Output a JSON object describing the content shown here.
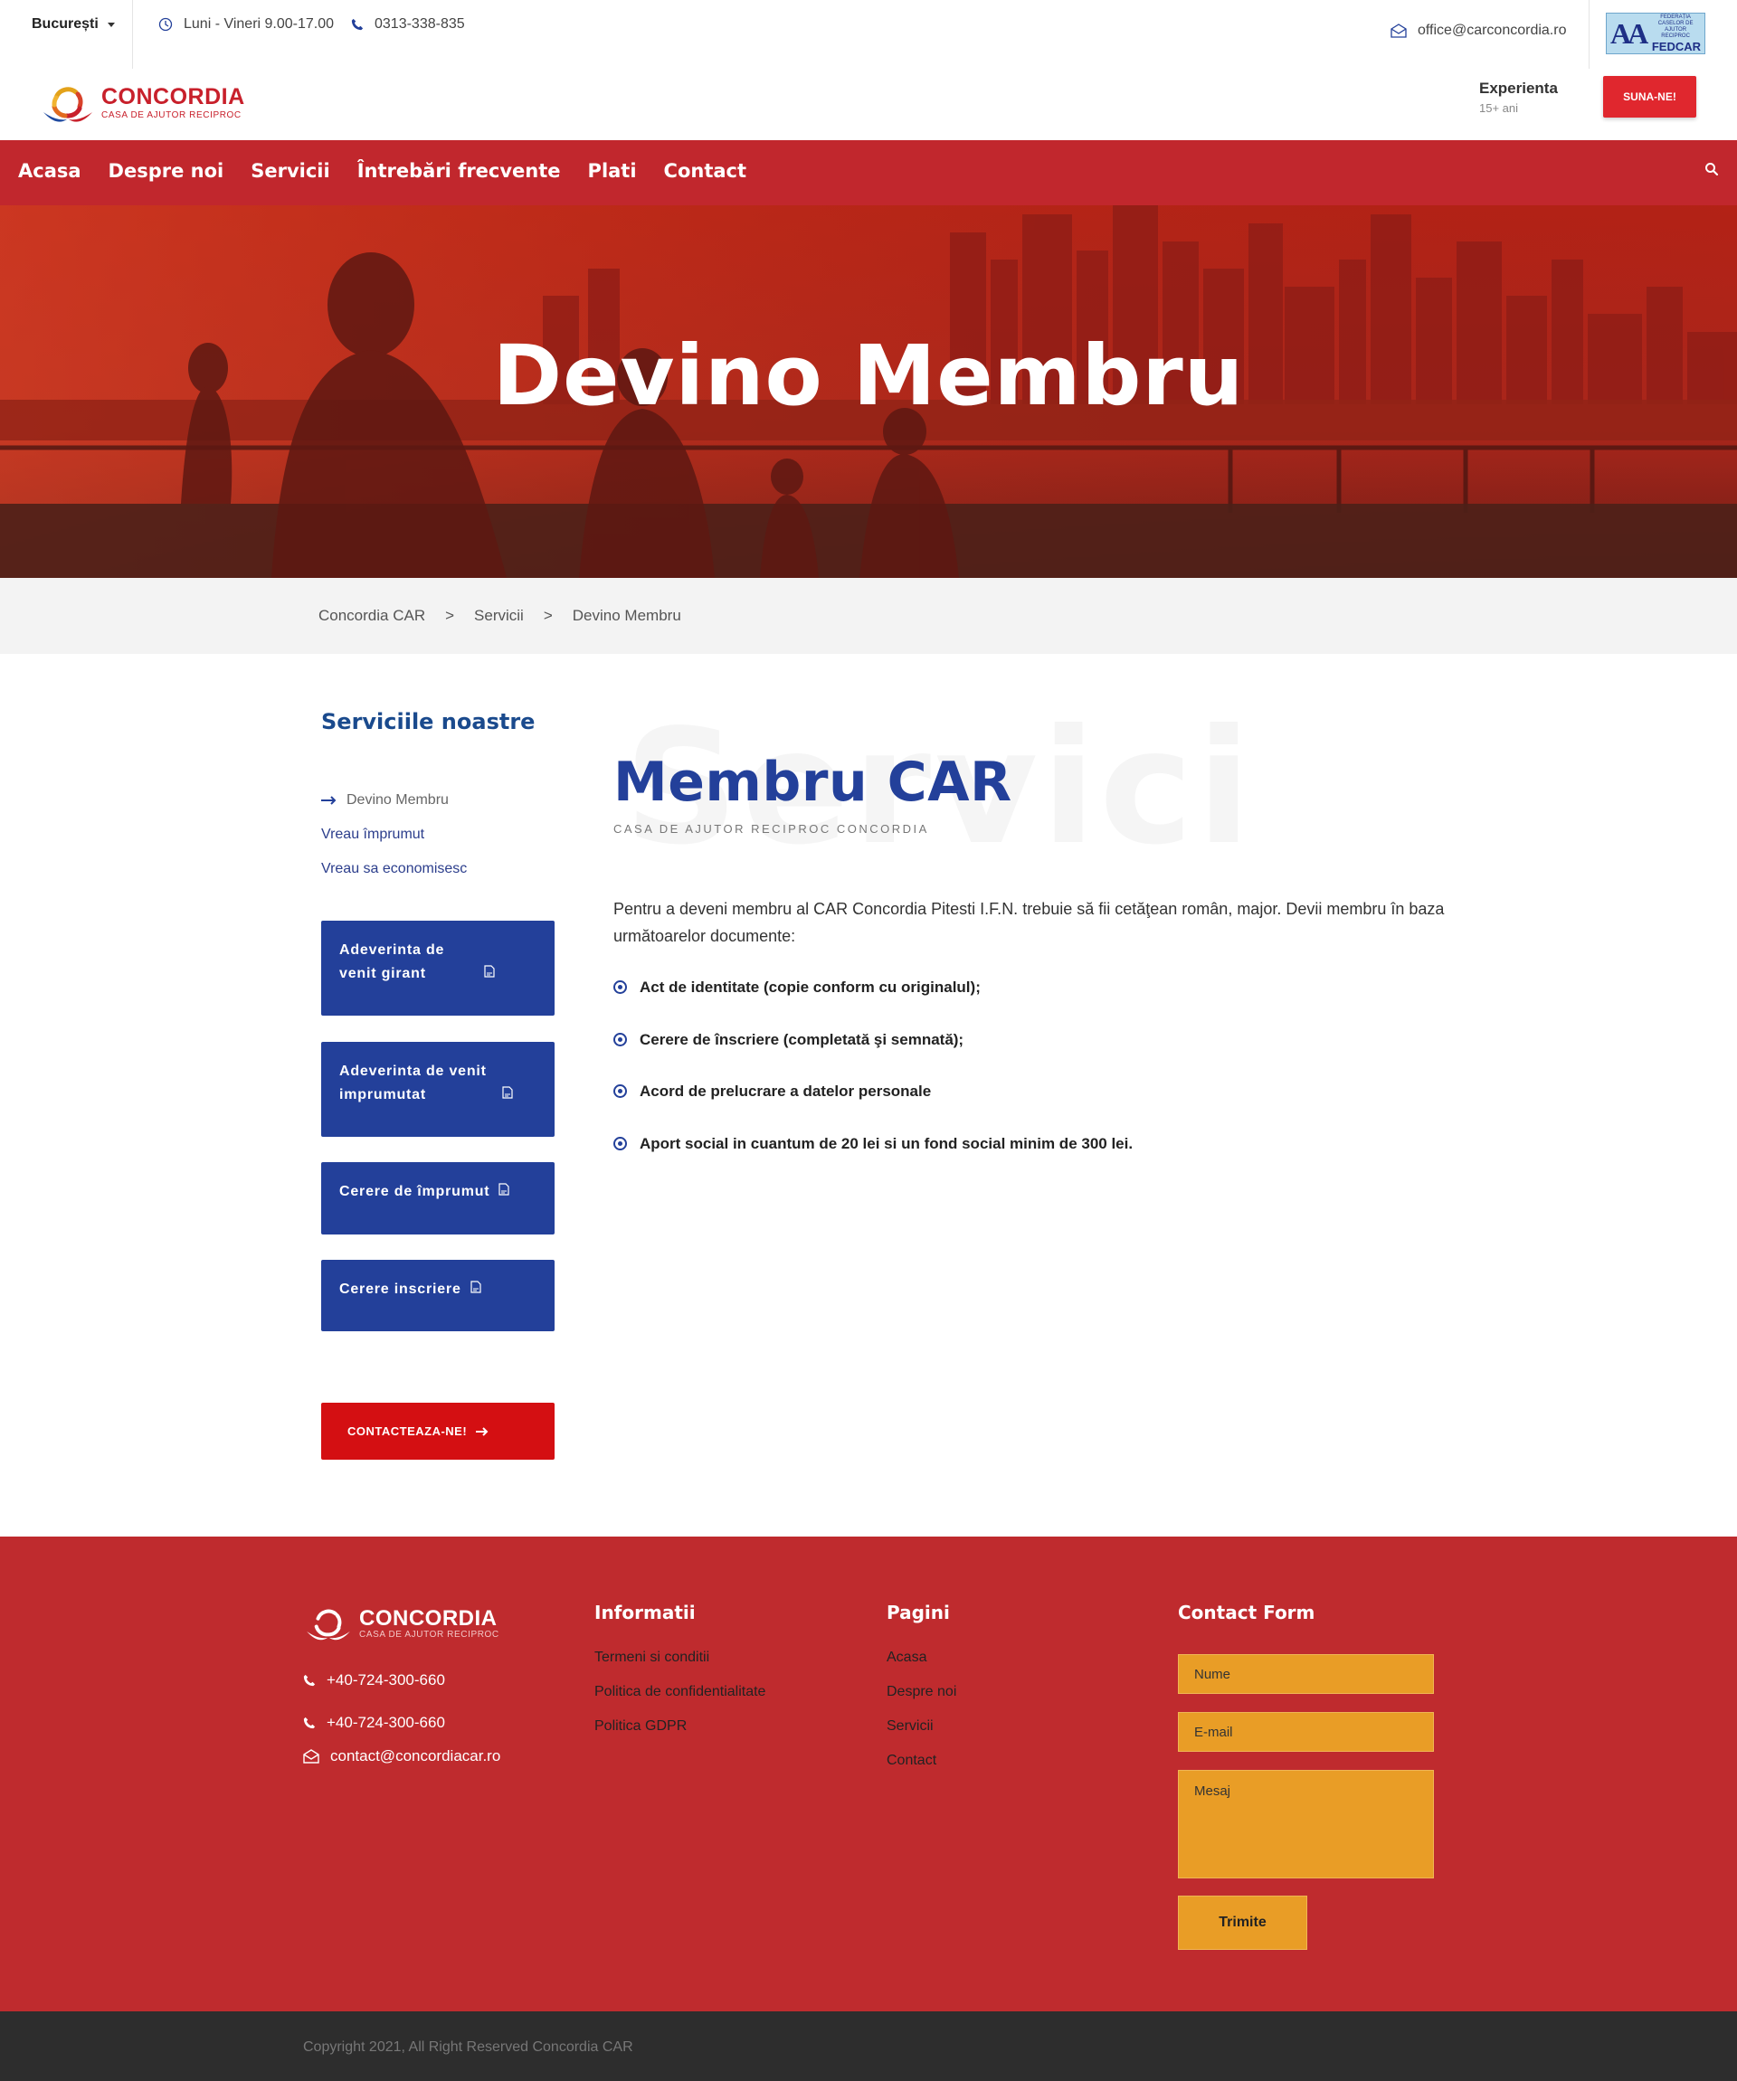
{
  "topbar": {
    "city": "București",
    "hours": "Luni - Vineri 9.00-17.00",
    "phone": "0313-338-835",
    "email": "office@carconcordia.ro",
    "partner": {
      "line1": "FEDERAȚIA CASELOR DE AJUTOR RECIPROC",
      "line2": "FEDCAR"
    }
  },
  "header": {
    "brand": "CONCORDIA",
    "tagline": "CASA DE AJUTOR RECIPROC",
    "experience_label": "Experienta",
    "experience_value": "15+ ani",
    "call_button": "SUNA-NE!"
  },
  "nav": {
    "items": [
      "Acasa",
      "Despre noi",
      "Servicii",
      "Întrebări frecvente",
      "Plati",
      "Contact"
    ]
  },
  "hero": {
    "title": "Devino Membru"
  },
  "breadcrumb": {
    "items": [
      "Concordia CAR",
      "Servicii",
      "Devino Membru"
    ],
    "separator": ">"
  },
  "watermark": "Servici",
  "sidebar": {
    "title": "Serviciile noastre",
    "links": [
      "Devino Membru",
      "Vreau împrumut",
      "Vreau sa economisesc"
    ],
    "documents": [
      "Adeverinta de venit girant",
      "Adeverinta de venit imprumutat",
      "Cerere de împrumut",
      "Cerere inscriere"
    ],
    "contact_button": "CONTACTEAZA-NE!"
  },
  "main": {
    "title": "Membru CAR",
    "subtitle": "CASA DE AJUTOR RECIPROC CONCORDIA",
    "intro": "Pentru a deveni membru al CAR Concordia Pitesti I.F.N. trebuie să fii cetăţean român, major. Devii membru în baza următoarelor documente:",
    "requirements": [
      "Act de identitate (copie conform cu originalul);",
      "Cerere de înscriere (completată şi semnată);",
      "Acord de prelucrare a datelor personale",
      "Aport social in cuantum de 20 lei si un fond social minim de 300 lei."
    ]
  },
  "footer": {
    "brand": "CONCORDIA",
    "tagline": "CASA DE AJUTOR RECIPROC",
    "phone1": "+40-724-300-660",
    "phone2": "+40-724-300-660",
    "email": "contact@concordiacar.ro",
    "info_title": "Informatii",
    "info_links": [
      "Termeni si conditii",
      "Politica de confidentialitate",
      "Politica GDPR"
    ],
    "pages_title": "Pagini",
    "pages_links": [
      "Acasa",
      "Despre noi",
      "Servicii",
      "Contact"
    ],
    "form_title": "Contact Form",
    "form": {
      "name_placeholder": "Nume",
      "email_placeholder": "E-mail",
      "message_placeholder": "Mesaj",
      "submit": "Trimite"
    },
    "copyright": "Copyright 2021, All Right Reserved Concordia CAR"
  },
  "colors": {
    "brand_red": "#c1272d",
    "primary_blue": "#23409a",
    "accent_orange": "#e99d26",
    "cta_red": "#d40f12"
  }
}
